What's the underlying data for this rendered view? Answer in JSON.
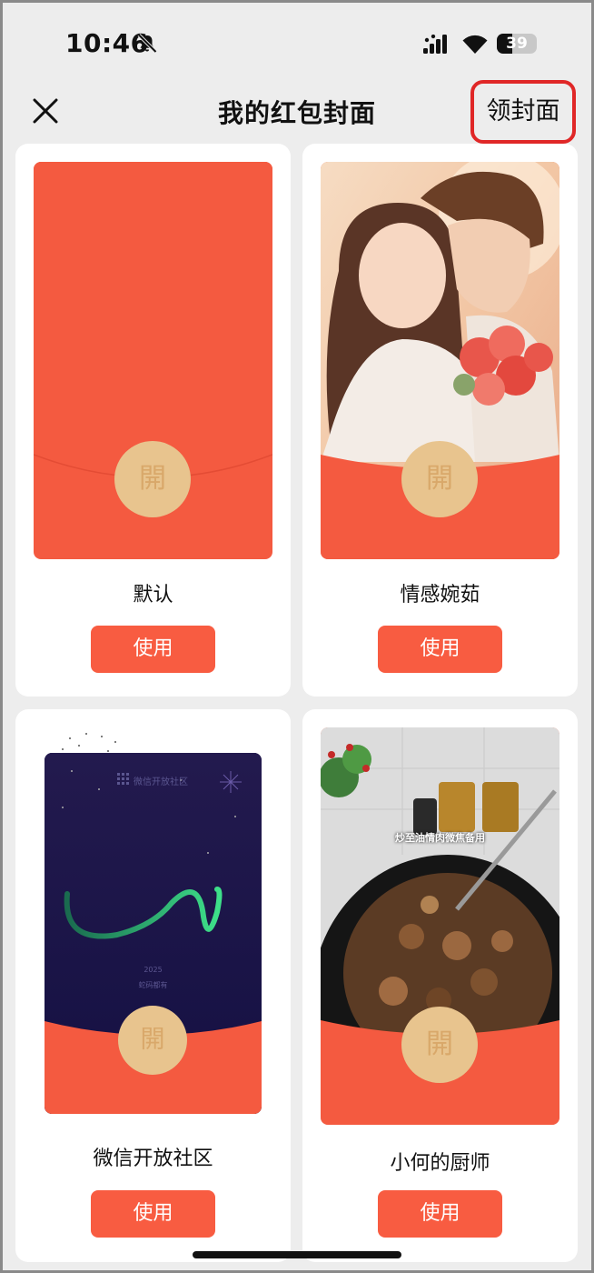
{
  "status_bar": {
    "time": "10:46",
    "battery": "39",
    "battery_level": 0.39,
    "icons": [
      "bell-slash-icon",
      "signal-icon",
      "wifi-icon",
      "battery-icon"
    ]
  },
  "nav": {
    "close_icon": "close-icon",
    "title": "我的红包封面",
    "get_cover_label": "领封面"
  },
  "seal_char": "開",
  "covers": [
    {
      "name": "默认",
      "use_label": "使用"
    },
    {
      "name": "情感婉茹",
      "use_label": "使用"
    },
    {
      "name": "微信开放社区",
      "use_label": "使用",
      "art_brand": "微信开放社区",
      "art_year": "2025",
      "art_caption": "蛇码都有"
    },
    {
      "name": "小何的厨师",
      "use_label": "使用",
      "art_caption": "炒至油情肉微焦备用"
    }
  ],
  "colors": {
    "cover_red": "#f45a40",
    "button_red": "#f85c41",
    "seal_gold": "#e8c48e",
    "highlight_red": "#e02727",
    "background": "#ededed"
  }
}
